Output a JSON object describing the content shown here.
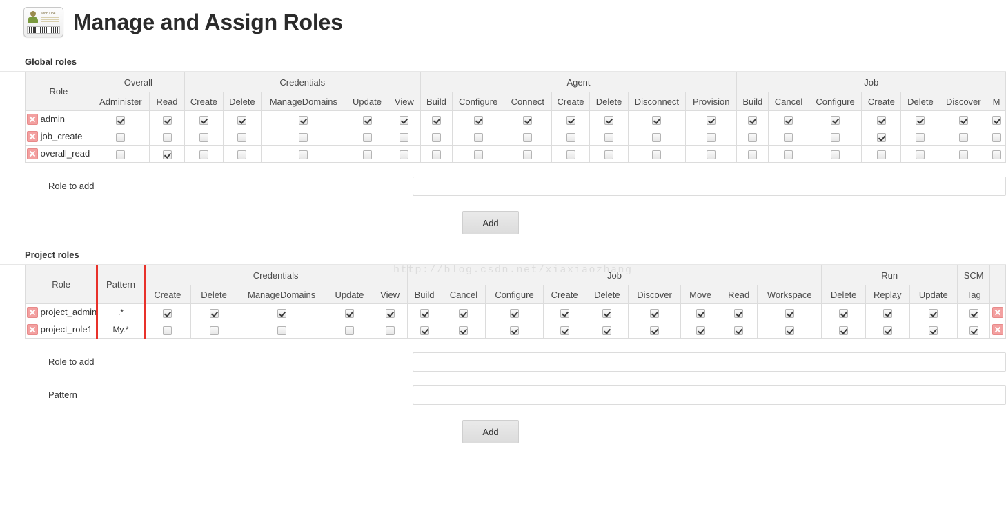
{
  "header": {
    "title": "Manage and Assign Roles",
    "badge_icon": "id-badge-icon",
    "badge_name": "John Doe"
  },
  "watermark": "http://blog.csdn.net/xiaxiaozhang",
  "colors": {
    "highlight": "#e8312a",
    "header_bg": "#f2f2f2",
    "border": "#dcdcdc",
    "delete_icon": "#f3a0a0"
  },
  "global_roles": {
    "section_title": "Global roles",
    "role_column_label": "Role",
    "groups": [
      {
        "label": "Overall",
        "columns": [
          "Administer",
          "Read"
        ]
      },
      {
        "label": "Credentials",
        "columns": [
          "Create",
          "Delete",
          "ManageDomains",
          "Update",
          "View"
        ]
      },
      {
        "label": "Agent",
        "columns": [
          "Build",
          "Configure",
          "Connect",
          "Create",
          "Delete",
          "Disconnect",
          "Provision"
        ]
      },
      {
        "label": "Job",
        "columns": [
          "Build",
          "Cancel",
          "Configure",
          "Create",
          "Delete",
          "Discover",
          "M"
        ]
      }
    ],
    "rows": [
      {
        "role": "admin",
        "delete_icon": "delete-icon",
        "permissions": [
          [
            true,
            true
          ],
          [
            true,
            true,
            true,
            true,
            true
          ],
          [
            true,
            true,
            true,
            true,
            true,
            true,
            true
          ],
          [
            true,
            true,
            true,
            true,
            true,
            true,
            true
          ]
        ]
      },
      {
        "role": "job_create",
        "delete_icon": "delete-icon",
        "permissions": [
          [
            false,
            false
          ],
          [
            false,
            false,
            false,
            false,
            false
          ],
          [
            false,
            false,
            false,
            false,
            false,
            false,
            false
          ],
          [
            false,
            false,
            false,
            true,
            false,
            false,
            false
          ]
        ]
      },
      {
        "role": "overall_read",
        "delete_icon": "delete-icon",
        "permissions": [
          [
            false,
            true
          ],
          [
            false,
            false,
            false,
            false,
            false
          ],
          [
            false,
            false,
            false,
            false,
            false,
            false,
            false
          ],
          [
            false,
            false,
            false,
            false,
            false,
            false,
            false
          ]
        ]
      }
    ],
    "form": {
      "role_to_add_label": "Role to add",
      "role_to_add_value": "",
      "role_to_add_placeholder": "",
      "add_label": "Add"
    }
  },
  "project_roles": {
    "section_title": "Project roles",
    "role_column_label": "Role",
    "pattern_column_label": "Pattern",
    "groups": [
      {
        "label": "Credentials",
        "columns": [
          "Create",
          "Delete",
          "ManageDomains",
          "Update",
          "View"
        ]
      },
      {
        "label": "Job",
        "columns": [
          "Build",
          "Cancel",
          "Configure",
          "Create",
          "Delete",
          "Discover",
          "Move",
          "Read",
          "Workspace"
        ]
      },
      {
        "label": "Run",
        "columns": [
          "Delete",
          "Replay",
          "Update"
        ]
      },
      {
        "label": "SCM",
        "columns": [
          "Tag"
        ]
      }
    ],
    "rows": [
      {
        "role": "project_admin",
        "pattern": ".*",
        "delete_icon": "delete-icon",
        "row_delete_icon": "delete-icon",
        "permissions": [
          [
            true,
            true,
            true,
            true,
            true
          ],
          [
            true,
            true,
            true,
            true,
            true,
            true,
            true,
            true,
            true
          ],
          [
            true,
            true,
            true
          ],
          [
            true
          ]
        ]
      },
      {
        "role": "project_role1",
        "pattern": "My.*",
        "delete_icon": "delete-icon",
        "row_delete_icon": "delete-icon",
        "permissions": [
          [
            false,
            false,
            false,
            false,
            false
          ],
          [
            true,
            true,
            true,
            true,
            true,
            true,
            true,
            true,
            true
          ],
          [
            true,
            true,
            true
          ],
          [
            true
          ]
        ]
      }
    ],
    "form": {
      "role_to_add_label": "Role to add",
      "role_to_add_value": "",
      "role_to_add_placeholder": "",
      "pattern_label": "Pattern",
      "pattern_value": "",
      "pattern_placeholder": "",
      "add_label": "Add"
    }
  }
}
